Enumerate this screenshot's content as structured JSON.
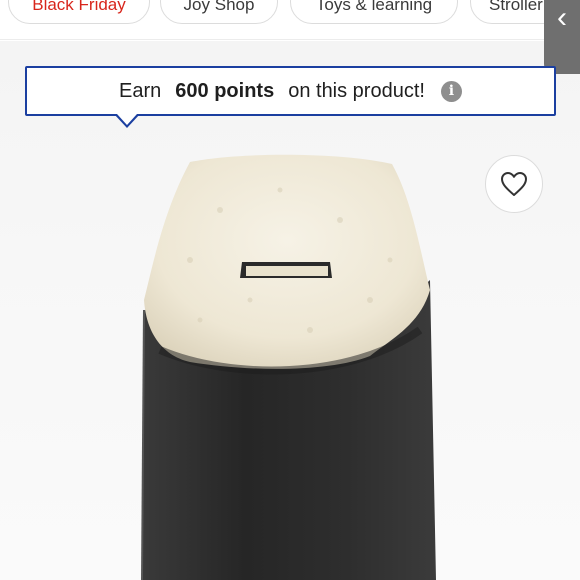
{
  "categories": [
    {
      "label": "Black Friday",
      "color": "#d8261c"
    },
    {
      "label": "Joy Shop"
    },
    {
      "label": "Toys & learning"
    },
    {
      "label": "Stroller"
    }
  ],
  "back_button": {
    "icon": "chevron-left-icon",
    "glyph": "‹"
  },
  "points_banner": {
    "prefix": "Earn",
    "points": "600 points",
    "suffix": "on this product!",
    "info_icon": "info-icon",
    "info_glyph": "i",
    "border_color": "#1b3fa0"
  },
  "favorite": {
    "icon": "heart-outline-icon"
  },
  "product_image": {
    "subject": "footmuff-icon",
    "colors": {
      "body": "#2b2b2b",
      "lining": "#f1ecdd"
    }
  }
}
